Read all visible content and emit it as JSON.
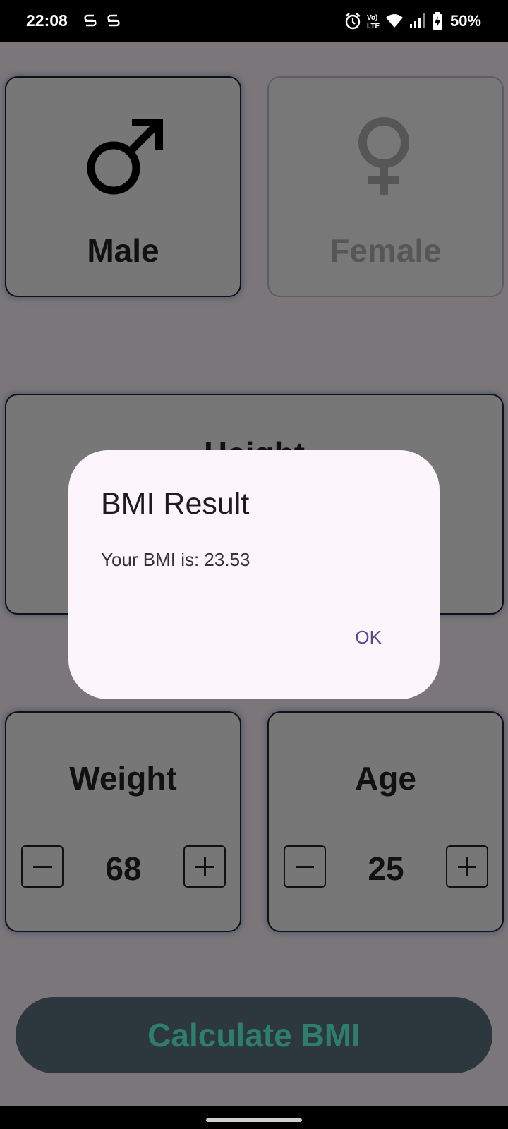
{
  "status_bar": {
    "time": "22:08",
    "battery_percent": "50%",
    "icons": [
      "notification-s-icon",
      "notification-s-icon",
      "alarm-icon",
      "volte-icon",
      "wifi-icon",
      "signal-icon",
      "battery-charging-icon"
    ]
  },
  "gender": {
    "male_label": "Male",
    "female_label": "Female",
    "selected": "male"
  },
  "height_card": {
    "title": "Height"
  },
  "weight_card": {
    "title": "Weight",
    "value": "68"
  },
  "age_card": {
    "title": "Age",
    "value": "25"
  },
  "calculate_button": {
    "label": "Calculate BMI"
  },
  "dialog": {
    "title": "BMI Result",
    "message": "Your BMI is: 23.53",
    "ok_label": "OK"
  },
  "colors": {
    "scrim_background": "#7b7679",
    "dialog_background": "#fcf5fc",
    "calculate_button_bg": "#2c383e",
    "calculate_button_text": "#2f7e6b",
    "dialog_action": "#5a4a8a"
  }
}
